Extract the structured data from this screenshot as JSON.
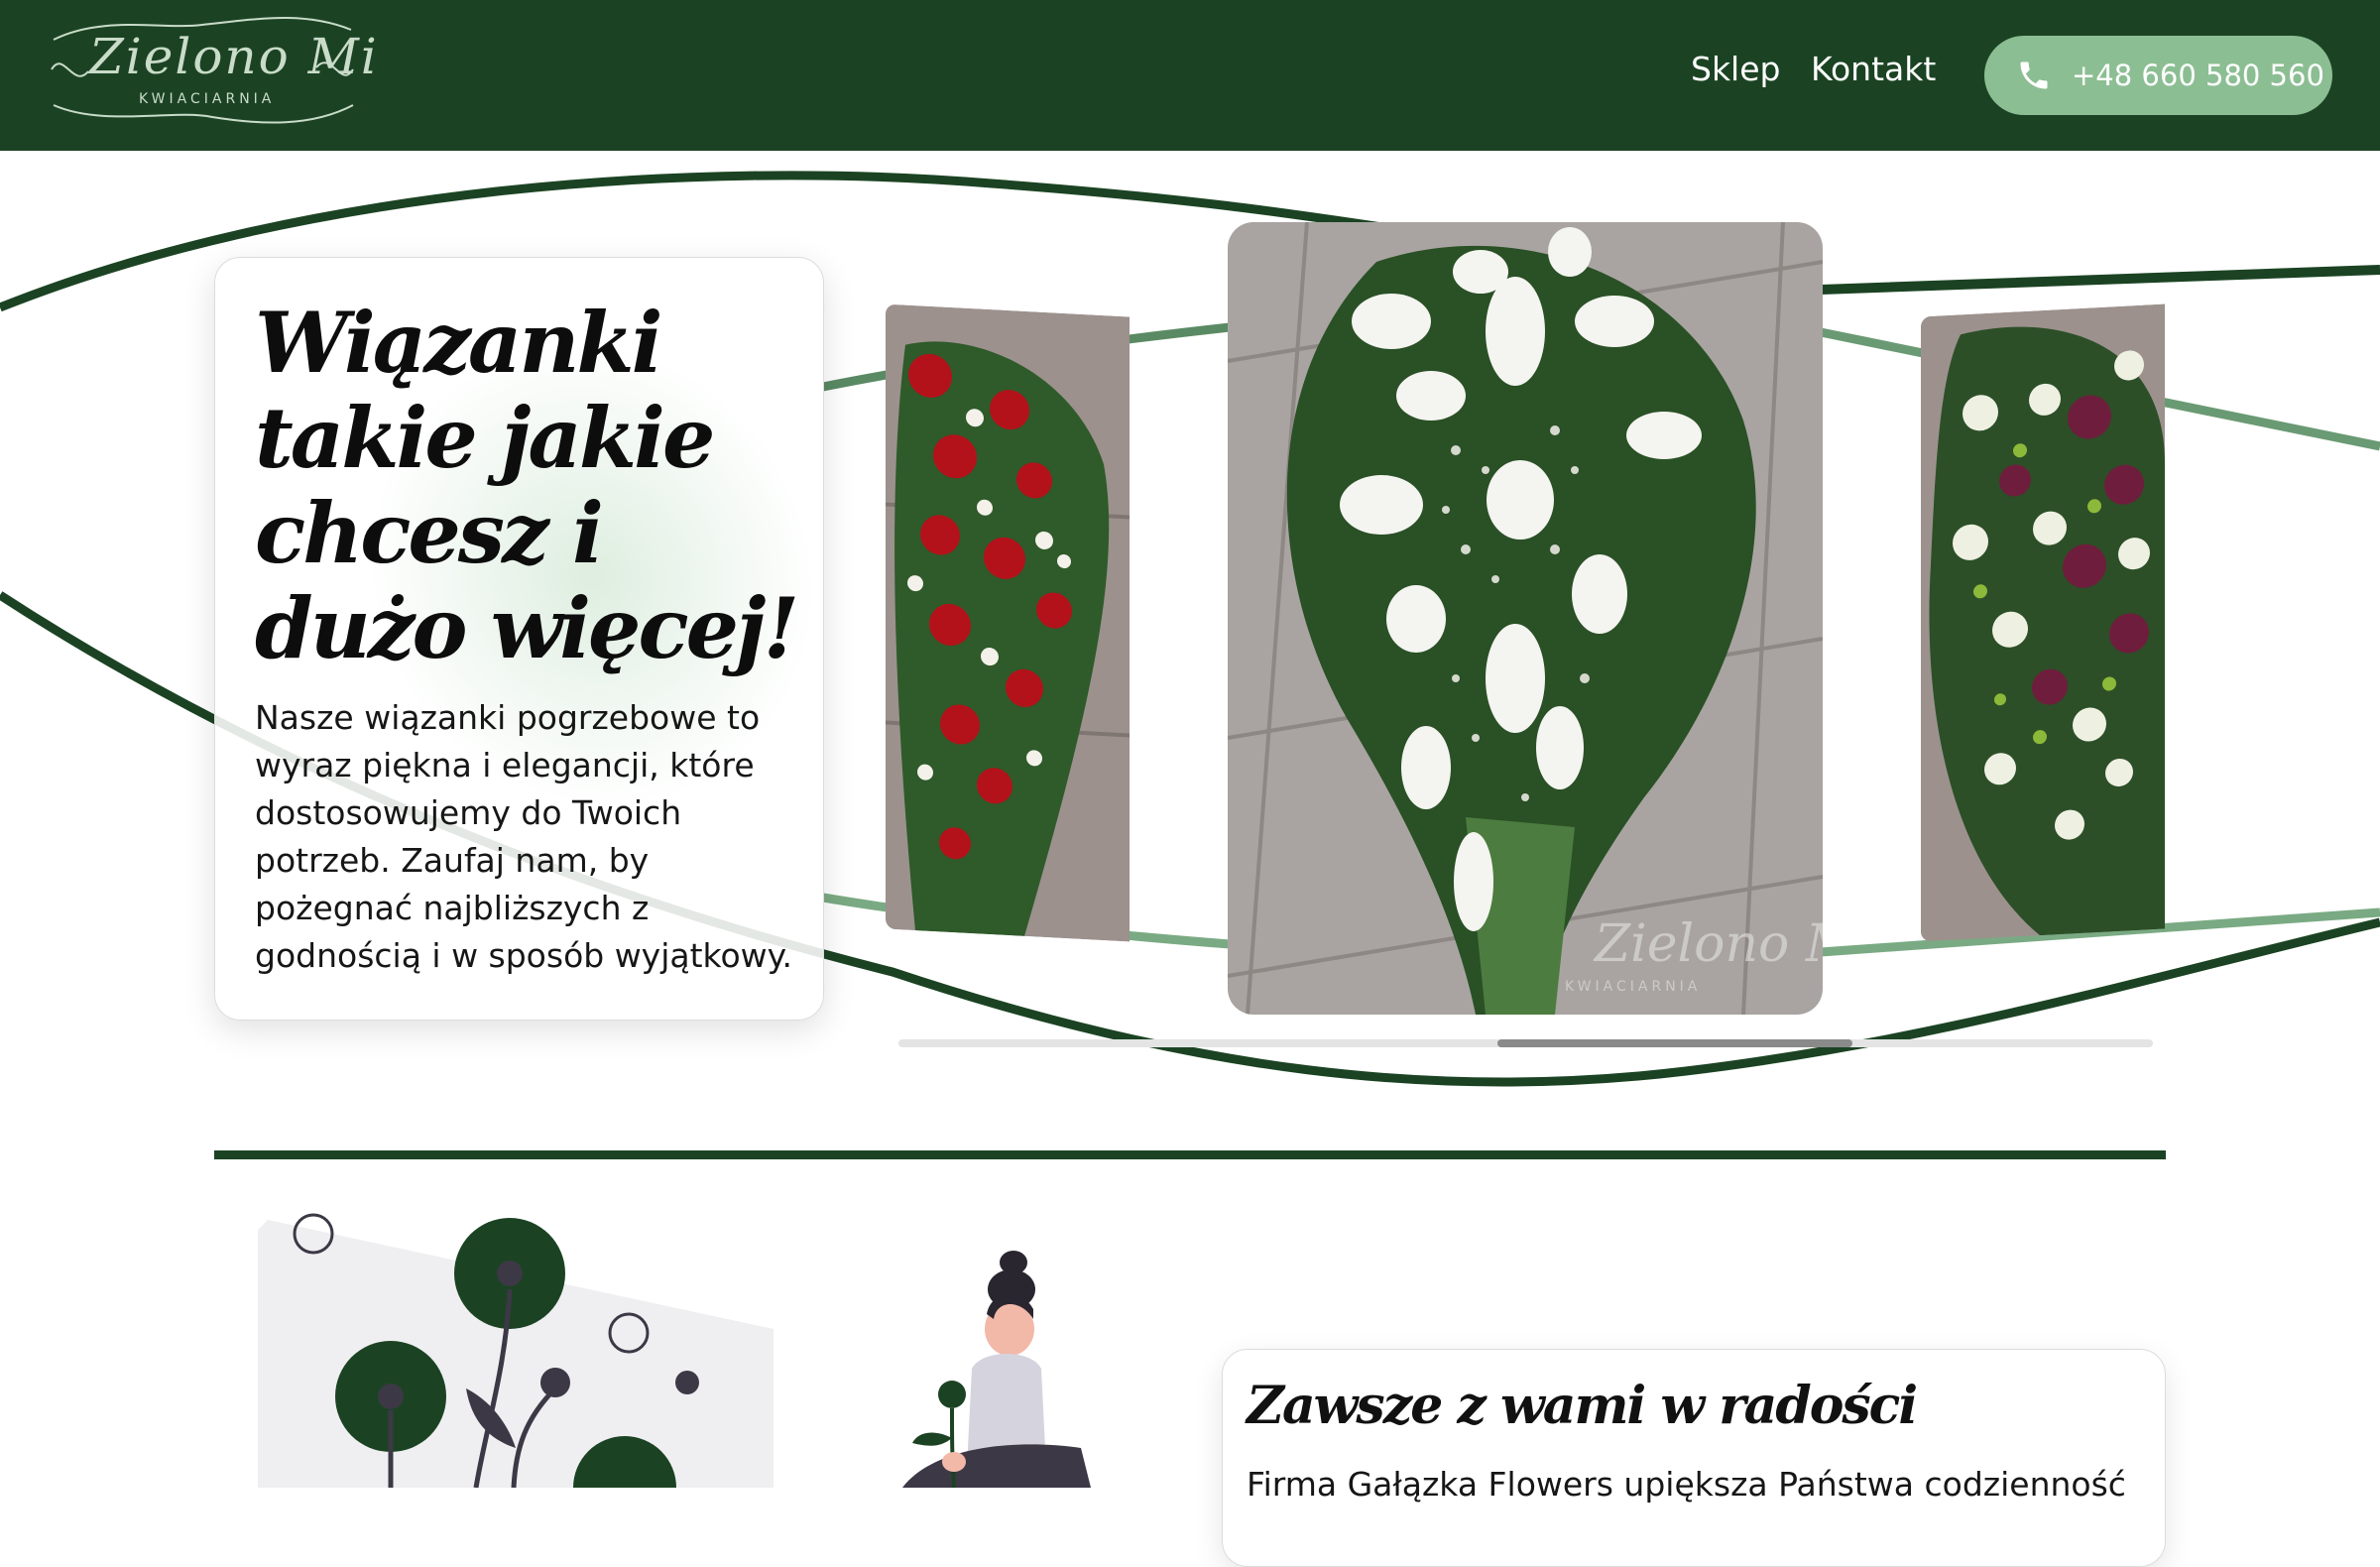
{
  "header": {
    "logo_name": "Zielono Mi",
    "logo_sub": "KWIACIARNIA",
    "nav": {
      "shop": "Sklep",
      "contact": "Kontakt"
    },
    "phone": "+48 660 580 560"
  },
  "hero": {
    "title": "Wiązanki takie jakie chcesz i dużo więcej!",
    "text": "Nasze wiązanki pogrzebowe to wyraz piękna i elegancji, które dostosowujemy do Twoich potrzeb. Zaufaj nam, by pożegnać najbliższych z godnością i w sposób wyjątkowy."
  },
  "carousel": {
    "slides": [
      "red-roses-wreath",
      "white-calla-lily-wreath",
      "white-purple-orchid-wreath"
    ],
    "watermark": "Zielono Mi",
    "watermark_sub": "KWIACIARNIA",
    "scroll_position": 0.55
  },
  "about": {
    "title": "Zawsze z wami w radości",
    "text": "Firma Gałązka Flowers upiększa Państwa codzienność"
  },
  "colors": {
    "brand_dark": "#1b4323",
    "accent": "#8cbe93",
    "ribbon": "#5a8a63"
  }
}
